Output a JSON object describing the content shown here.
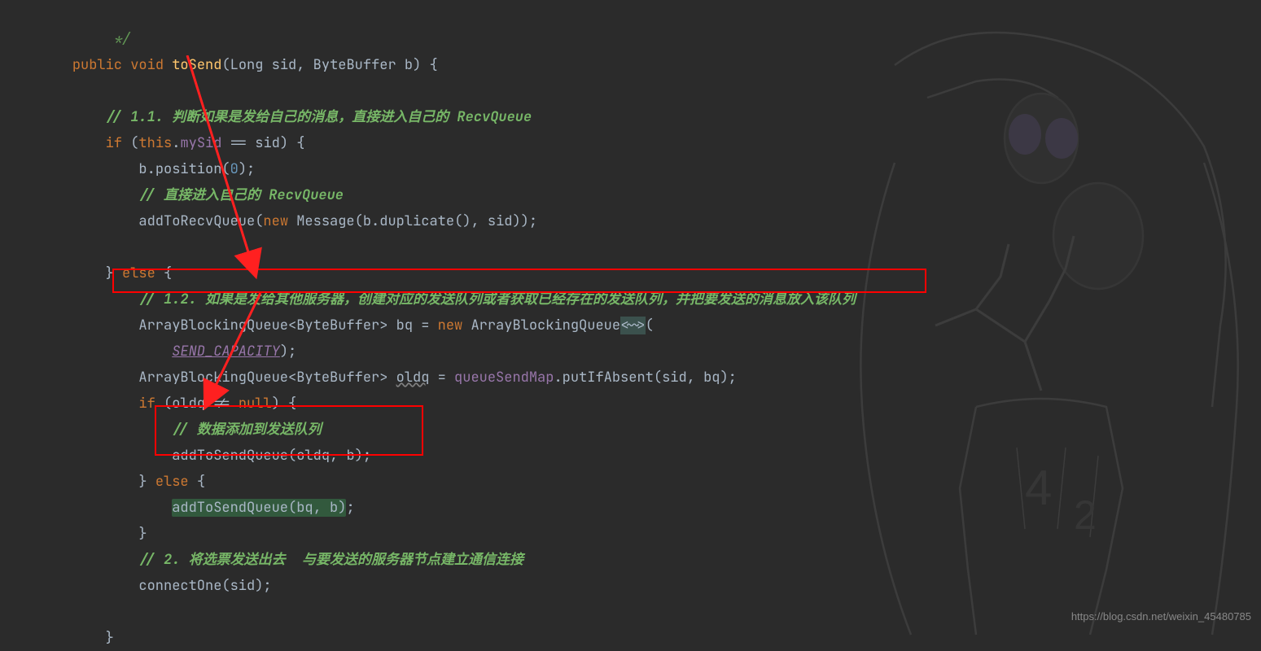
{
  "code": {
    "l1": "         */",
    "l2_kw1": "public",
    "l2_kw2": "void",
    "l2_method": "toSend",
    "l2_p1t": "Long",
    "l2_p1n": "sid",
    "l2_p2t": "ByteBuffer",
    "l2_p2n": "b",
    "l4_cmt": "// 1.1. 判断如果是发给自己的消息，直接进入自己的 RecvQueue",
    "l5_kw": "if",
    "l5_this": "this",
    "l5_field": "mySid",
    "l5_op": " == ",
    "l5_var": "sid",
    "l6_var": "b",
    "l6_call": "position",
    "l6_num": "0",
    "l7_cmt": "// 直接进入自己的 RecvQueue",
    "l8_call": "addToRecvQueue",
    "l8_kw": "new",
    "l8_type": "Message",
    "l8_var": "b",
    "l8_m": "duplicate",
    "l8_var2": "sid",
    "l10_kw": "else",
    "l11_cmt": "// 1.2. 如果是发给其他服务器，创建对应的发送队列或者获取已经存在的发送队列，并把要发送的消息放入该队列",
    "l12_type1": "ArrayBlockingQueue",
    "l12_type2": "ByteBuffer",
    "l12_var": "bq",
    "l12_kw": "new",
    "l12_type3": "ArrayBlockingQueue",
    "l12_gen": "<~>",
    "l13_const": "SEND_CAPACITY",
    "l14_type1": "ArrayBlockingQueue",
    "l14_type2": "ByteBuffer",
    "l14_var": "oldq",
    "l14_field": "queueSendMap",
    "l14_call": "putIfAbsent",
    "l14_p1": "sid",
    "l14_p2": "bq",
    "l15_kw": "if",
    "l15_var": "oldq",
    "l15_op": " != ",
    "l15_null": "null",
    "l16_cmt": "// 数据添加到发送队列",
    "l17_call": "addToSendQueue",
    "l17_p1": "oldq",
    "l17_p2": "b",
    "l18_kw": "else",
    "l19_call": "addToSendQueue",
    "l19_p1": "bq",
    "l19_p2": "b",
    "l21_cmt": "// 2. 将选票发送出去  与要发送的服务器节点建立通信连接",
    "l22_call": "connectOne",
    "l22_p1": "sid"
  },
  "watermark": "https://blog.csdn.net/weixin_45480785"
}
